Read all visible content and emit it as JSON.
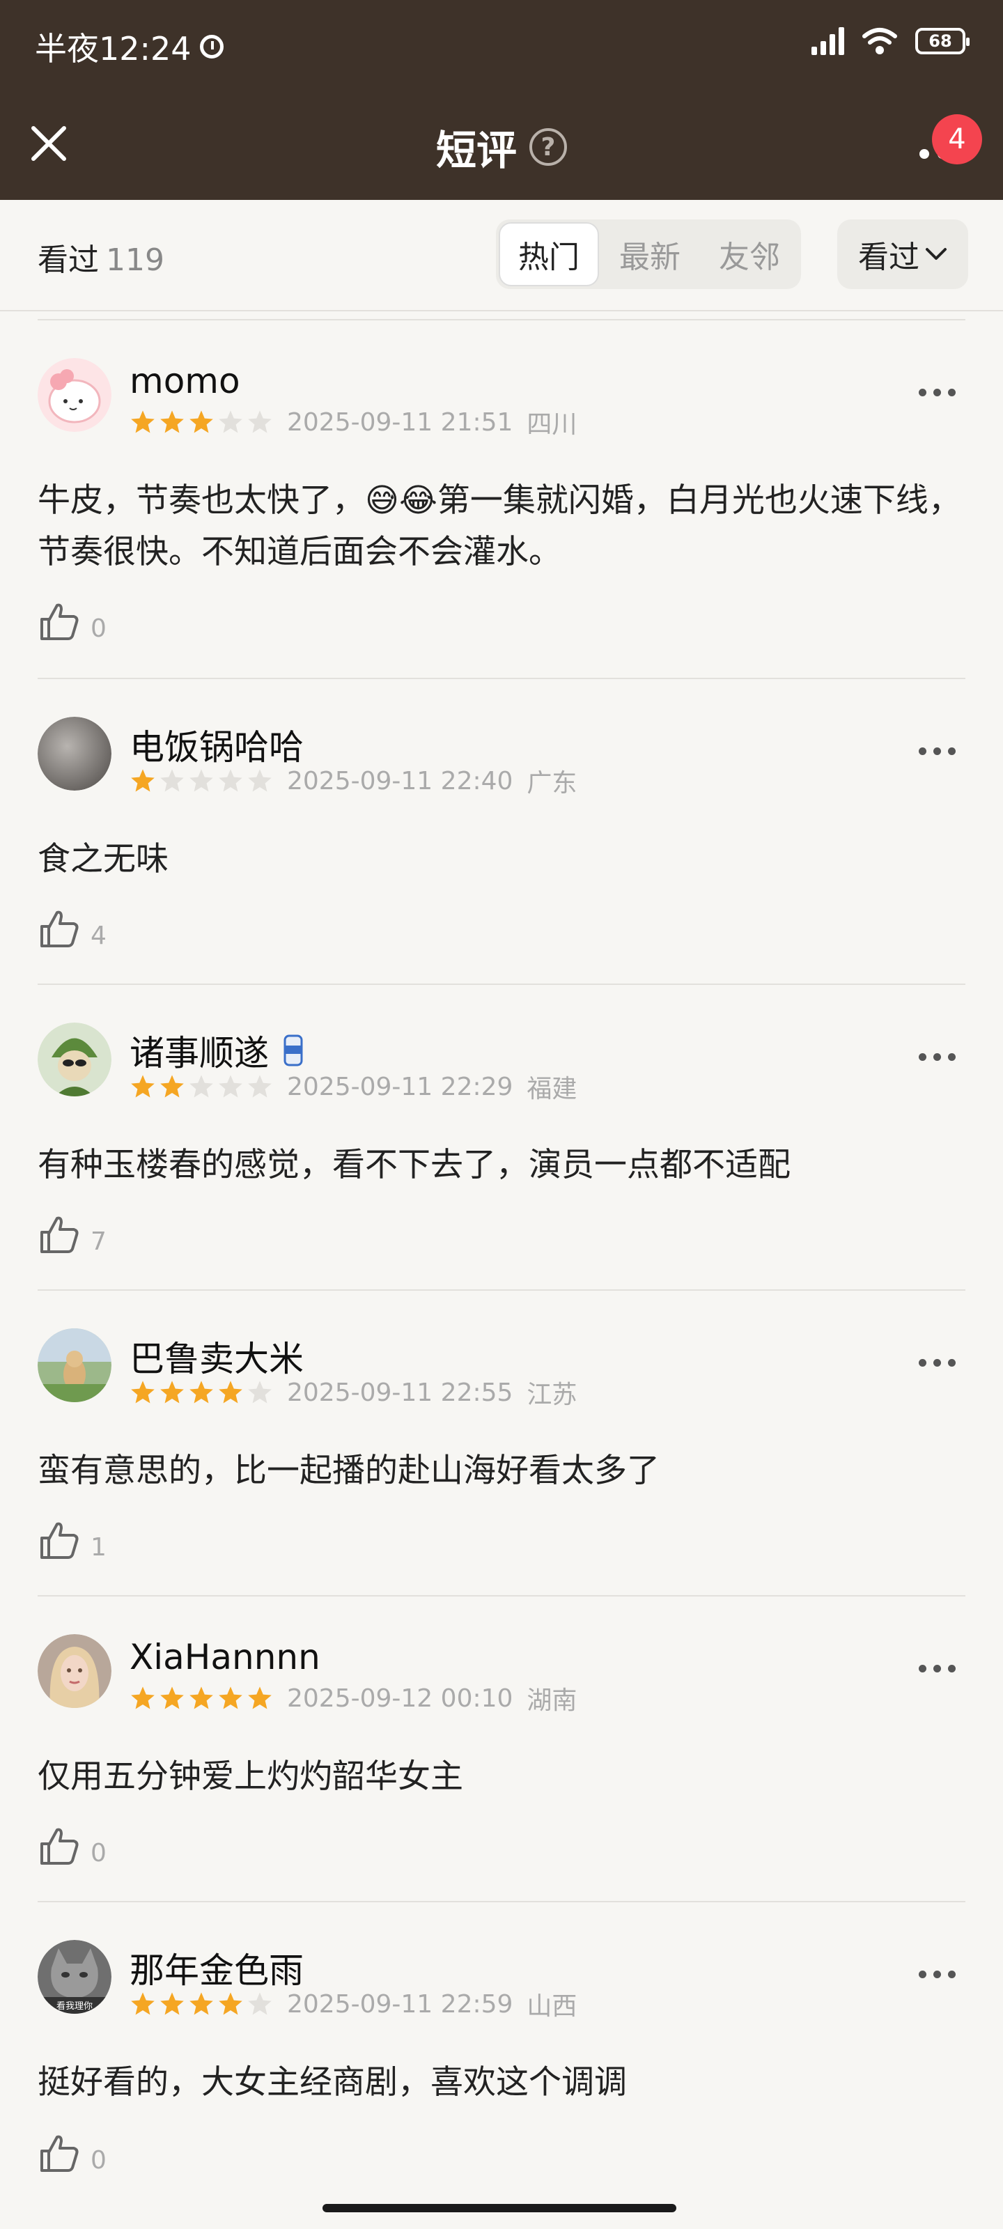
{
  "status": {
    "time": "半夜12:24",
    "battery": "68"
  },
  "header": {
    "title": "短评",
    "help": "?",
    "badge": "4"
  },
  "filter": {
    "seen_label": "看过",
    "seen_count": "119",
    "tabs": [
      "热门",
      "最新",
      "友邻"
    ],
    "dropdown": "看过"
  },
  "colors": {
    "header_bg": "#3e3229",
    "star": "#f5a623",
    "badge": "#f4444f"
  },
  "reviews": [
    {
      "name": "momo",
      "rating": 3,
      "date": "2025-09-11 21:51",
      "region": "四川",
      "text": "牛皮，节奏也太快了，😅😂第一集就闪婚，白月光也火速下线，节奏很快。不知道后面会不会灌水。",
      "likes": "0"
    },
    {
      "name": "电饭锅哈哈",
      "rating": 1,
      "date": "2025-09-11 22:40",
      "region": "广东",
      "text": "食之无味",
      "likes": "4"
    },
    {
      "name": "诸事顺遂",
      "rating": 2,
      "date": "2025-09-11 22:29",
      "region": "福建",
      "text": "有种玉楼春的感觉，看不下去了，演员一点都不适配",
      "likes": "7"
    },
    {
      "name": "巴鲁卖大米",
      "rating": 4,
      "date": "2025-09-11 22:55",
      "region": "江苏",
      "text": "蛮有意思的，比一起播的赴山海好看太多了",
      "likes": "1"
    },
    {
      "name": "XiaHannnn",
      "rating": 5,
      "date": "2025-09-12 00:10",
      "region": "湖南",
      "text": "仅用五分钟爱上灼灼韶华女主",
      "likes": "0"
    },
    {
      "name": "那年金色雨",
      "rating": 4,
      "date": "2025-09-11 22:59",
      "region": "山西",
      "text": "挺好看的，大女主经商剧，喜欢这个调调",
      "likes": "0",
      "avatar_caption": "看我理你"
    }
  ]
}
